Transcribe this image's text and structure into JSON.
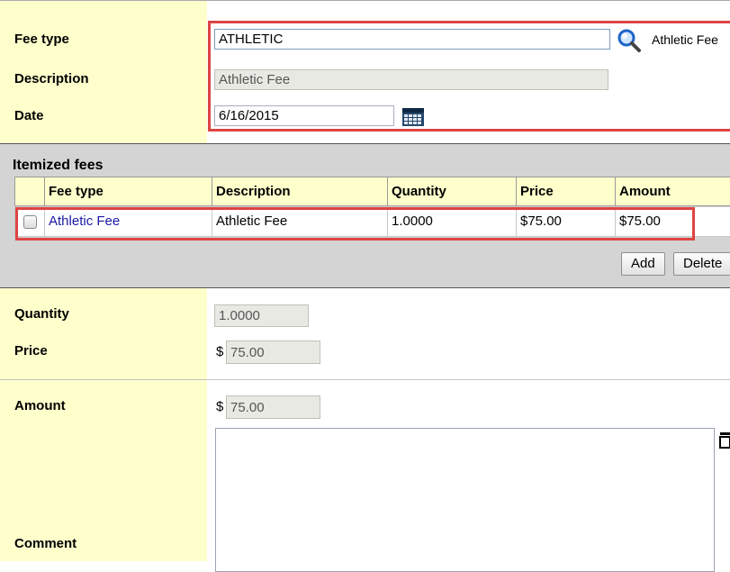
{
  "header_form": {
    "fee_type_label": "Fee type",
    "fee_type_value": "ATHLETIC",
    "fee_type_lookup_text": "Athletic Fee",
    "description_label": "Description",
    "description_value": "Athletic Fee",
    "date_label": "Date",
    "date_value": "6/16/2015"
  },
  "itemized": {
    "title": "Itemized fees",
    "columns": [
      "Fee type",
      "Description",
      "Quantity",
      "Price",
      "Amount"
    ],
    "rows": [
      {
        "fee_type": "Athletic Fee",
        "description": "Athletic Fee",
        "quantity": "1.0000",
        "price": "$75.00",
        "amount": "$75.00"
      }
    ],
    "add_label": "Add",
    "delete_label": "Delete"
  },
  "detail_form": {
    "quantity_label": "Quantity",
    "quantity_value": "1.0000",
    "price_label": "Price",
    "price_currency": "$",
    "price_value": "75.00",
    "amount_label": "Amount",
    "amount_currency": "$",
    "amount_value": "75.00",
    "comment_label": "Comment",
    "comment_value": ""
  },
  "colors": {
    "label_bg": "#ffffcc",
    "highlight": "#dd4444",
    "link": "#1a1aa6",
    "toolbar_bg": "#d4d4d4"
  },
  "icons": [
    "search-icon",
    "calendar-icon",
    "expand-icon"
  ]
}
